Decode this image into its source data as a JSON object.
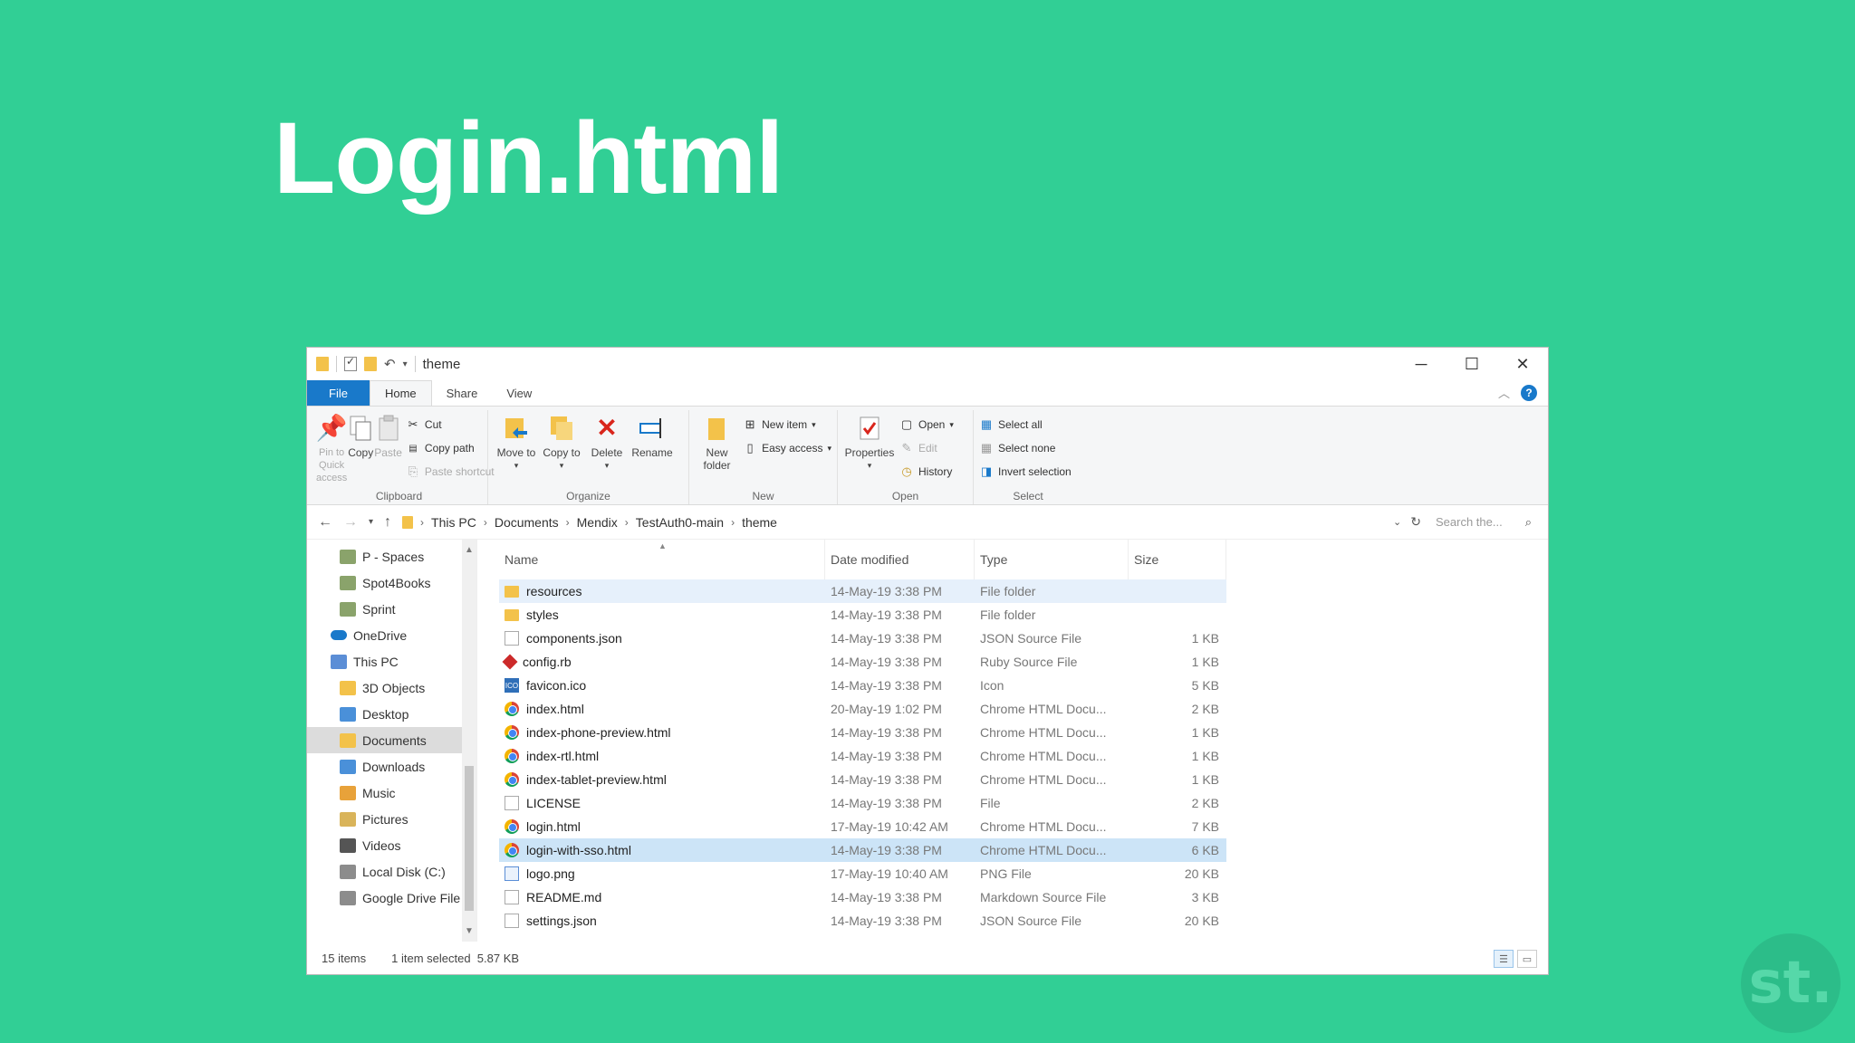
{
  "slide": {
    "title": "Login.html"
  },
  "window": {
    "title": "theme",
    "controls": {
      "minimize": "─",
      "maximize": "☐",
      "close": "✕"
    }
  },
  "ribbon": {
    "tabs": [
      "File",
      "Home",
      "Share",
      "View"
    ],
    "active_tab": "Home",
    "clipboard": {
      "label": "Clipboard",
      "pin": "Pin to Quick access",
      "copy": "Copy",
      "paste": "Paste",
      "cut": "Cut",
      "copy_path": "Copy path",
      "paste_shortcut": "Paste shortcut"
    },
    "organize": {
      "label": "Organize",
      "move_to": "Move to",
      "copy_to": "Copy to",
      "delete": "Delete",
      "rename": "Rename"
    },
    "new": {
      "label": "New",
      "new_folder": "New folder",
      "new_item": "New item",
      "easy_access": "Easy access"
    },
    "open": {
      "label": "Open",
      "properties": "Properties",
      "open": "Open",
      "edit": "Edit",
      "history": "History"
    },
    "select": {
      "label": "Select",
      "select_all": "Select all",
      "select_none": "Select none",
      "invert": "Invert selection"
    }
  },
  "address": {
    "crumbs": [
      "This PC",
      "Documents",
      "Mendix",
      "TestAuth0-main",
      "theme"
    ],
    "search_placeholder": "Search the..."
  },
  "navpane": {
    "items": [
      {
        "label": "P - Spaces",
        "icon": "network-folder-icon",
        "indent": 1
      },
      {
        "label": "Spot4Books",
        "icon": "network-folder-icon",
        "indent": 1
      },
      {
        "label": "Sprint",
        "icon": "network-folder-icon",
        "indent": 1
      },
      {
        "label": "OneDrive",
        "icon": "cloud-icon",
        "indent": 0
      },
      {
        "label": "This PC",
        "icon": "computer-icon",
        "indent": 0
      },
      {
        "label": "3D Objects",
        "icon": "folder-icon",
        "indent": 1
      },
      {
        "label": "Desktop",
        "icon": "desktop-icon",
        "indent": 1
      },
      {
        "label": "Documents",
        "icon": "folder-icon",
        "indent": 1
      },
      {
        "label": "Downloads",
        "icon": "download-icon",
        "indent": 1
      },
      {
        "label": "Music",
        "icon": "music-icon",
        "indent": 1
      },
      {
        "label": "Pictures",
        "icon": "pictures-icon",
        "indent": 1
      },
      {
        "label": "Videos",
        "icon": "video-icon",
        "indent": 1
      },
      {
        "label": "Local Disk (C:)",
        "icon": "drive-icon",
        "indent": 1
      },
      {
        "label": "Google Drive File",
        "icon": "drive-icon",
        "indent": 1
      }
    ],
    "selected": "Documents"
  },
  "files": {
    "columns": {
      "name": "Name",
      "date": "Date modified",
      "type": "Type",
      "size": "Size"
    },
    "rows": [
      {
        "name": "resources",
        "date": "14-May-19 3:38 PM",
        "type": "File folder",
        "size": "",
        "icon": "folder"
      },
      {
        "name": "styles",
        "date": "14-May-19 3:38 PM",
        "type": "File folder",
        "size": "",
        "icon": "folder"
      },
      {
        "name": "components.json",
        "date": "14-May-19 3:38 PM",
        "type": "JSON Source File",
        "size": "1 KB",
        "icon": "doc"
      },
      {
        "name": "config.rb",
        "date": "14-May-19 3:38 PM",
        "type": "Ruby Source File",
        "size": "1 KB",
        "icon": "ruby"
      },
      {
        "name": "favicon.ico",
        "date": "14-May-19 3:38 PM",
        "type": "Icon",
        "size": "5 KB",
        "icon": "ico"
      },
      {
        "name": "index.html",
        "date": "20-May-19 1:02 PM",
        "type": "Chrome HTML Docu...",
        "size": "2 KB",
        "icon": "chrome"
      },
      {
        "name": "index-phone-preview.html",
        "date": "14-May-19 3:38 PM",
        "type": "Chrome HTML Docu...",
        "size": "1 KB",
        "icon": "chrome"
      },
      {
        "name": "index-rtl.html",
        "date": "14-May-19 3:38 PM",
        "type": "Chrome HTML Docu...",
        "size": "1 KB",
        "icon": "chrome"
      },
      {
        "name": "index-tablet-preview.html",
        "date": "14-May-19 3:38 PM",
        "type": "Chrome HTML Docu...",
        "size": "1 KB",
        "icon": "chrome"
      },
      {
        "name": "LICENSE",
        "date": "14-May-19 3:38 PM",
        "type": "File",
        "size": "2 KB",
        "icon": "doc"
      },
      {
        "name": "login.html",
        "date": "17-May-19 10:42 AM",
        "type": "Chrome HTML Docu...",
        "size": "7 KB",
        "icon": "chrome"
      },
      {
        "name": "login-with-sso.html",
        "date": "14-May-19 3:38 PM",
        "type": "Chrome HTML Docu...",
        "size": "6 KB",
        "icon": "chrome"
      },
      {
        "name": "logo.png",
        "date": "17-May-19 10:40 AM",
        "type": "PNG File",
        "size": "20 KB",
        "icon": "img"
      },
      {
        "name": "README.md",
        "date": "14-May-19 3:38 PM",
        "type": "Markdown Source File",
        "size": "3 KB",
        "icon": "doc"
      },
      {
        "name": "settings.json",
        "date": "14-May-19 3:38 PM",
        "type": "JSON Source File",
        "size": "20 KB",
        "icon": "doc"
      }
    ],
    "hover_row": "resources",
    "selected_row": "login-with-sso.html"
  },
  "status": {
    "count": "15 items",
    "selection": "1 item selected  5.87 KB"
  },
  "colors": {
    "background": "#31cf95",
    "file_tab": "#1979ca",
    "selection": "#cce4f7"
  },
  "brand": {
    "logo_text": "st."
  }
}
